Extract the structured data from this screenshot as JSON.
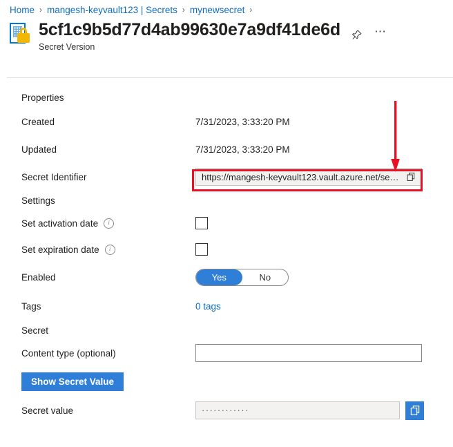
{
  "breadcrumb": {
    "items": [
      {
        "label": "Home"
      },
      {
        "label": "mangesh-keyvault123 | Secrets"
      },
      {
        "label": "mynewsecret"
      }
    ],
    "separator": "›"
  },
  "header": {
    "title": "5cf1c9b5d77d4ab99630e7a9df41de6d",
    "subtitle": "Secret Version",
    "resource_icon": "secret-version-icon",
    "pin_icon": "pin-icon",
    "more_icon": "ellipsis-icon"
  },
  "sections": {
    "properties_heading": "Properties",
    "settings_heading": "Settings",
    "secret_heading": "Secret"
  },
  "properties": {
    "created_label": "Created",
    "created_value": "7/31/2023, 3:33:20 PM",
    "updated_label": "Updated",
    "updated_value": "7/31/2023, 3:33:20 PM",
    "secret_identifier_label": "Secret Identifier",
    "secret_identifier_value": "https://mangesh-keyvault123.vault.azure.net/secr...",
    "secret_identifier_copy_icon": "copy-icon"
  },
  "settings": {
    "activation_label": "Set activation date",
    "activation_info_icon": "info-icon",
    "activation_checked": false,
    "expiration_label": "Set expiration date",
    "expiration_info_icon": "info-icon",
    "expiration_checked": false,
    "enabled_label": "Enabled",
    "enabled_yes": "Yes",
    "enabled_no": "No",
    "enabled_selected": "Yes",
    "tags_label": "Tags",
    "tags_value": "0 tags"
  },
  "secret": {
    "content_type_label": "Content type (optional)",
    "content_type_value": "",
    "content_type_placeholder": "",
    "show_secret_button": "Show Secret Value",
    "secret_value_label": "Secret value",
    "secret_value_masked": "············",
    "secret_value_copy_icon": "copy-icon"
  },
  "annotation": {
    "highlight_color": "#e81123",
    "arrow_icon": "down-arrow-annotation",
    "target": "secret-identifier-field"
  },
  "colors": {
    "accent_blue": "#2f7fd8",
    "link_blue": "#0f6cbd",
    "annotation_red": "#e81123",
    "lock_gold": "#f2b705"
  }
}
